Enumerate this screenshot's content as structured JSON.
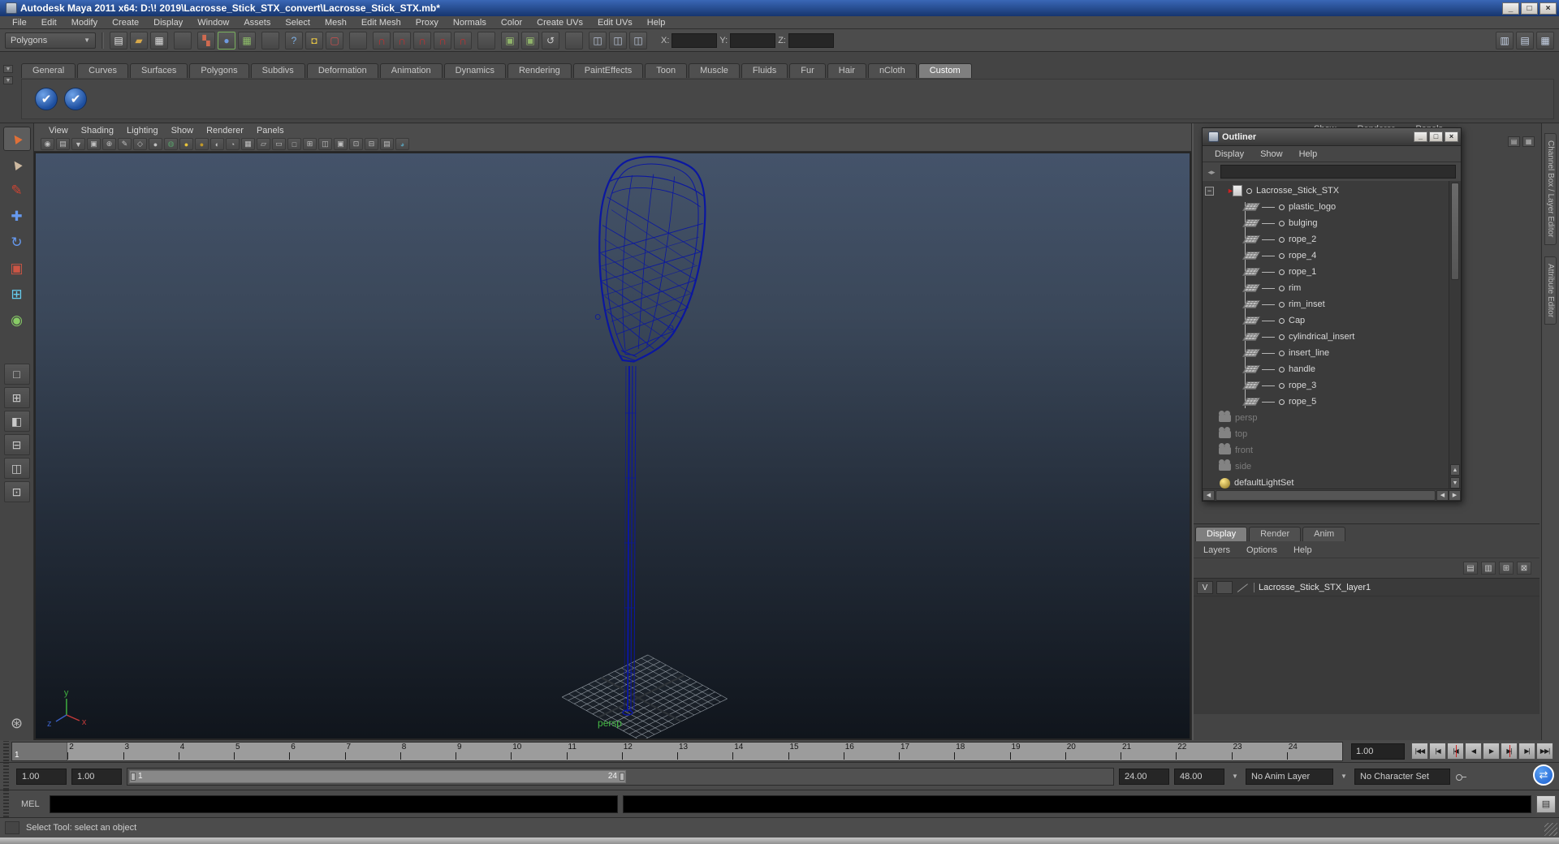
{
  "window": {
    "title": "Autodesk Maya 2011 x64: D:\\! 2019\\Lacrosse_Stick_STX_convert\\Lacrosse_Stick_STX.mb*",
    "minimize": "_",
    "maximize": "□",
    "close": "×"
  },
  "menubar": {
    "items": [
      "File",
      "Edit",
      "Modify",
      "Create",
      "Display",
      "Window",
      "Assets",
      "Select",
      "Mesh",
      "Edit Mesh",
      "Proxy",
      "Normals",
      "Color",
      "Create UVs",
      "Edit UVs",
      "Help"
    ]
  },
  "statusline": {
    "mode_label": "Polygons",
    "dropdown_arrow": "▼",
    "icons": [
      {
        "n": "new-scene-icon",
        "g": "▤",
        "c": "#e6e6e6"
      },
      {
        "n": "open-scene-icon",
        "g": "▰",
        "c": "#d8a94a"
      },
      {
        "n": "save-scene-icon",
        "g": "▦",
        "c": "#dcdcdc"
      },
      {
        "n": "divider",
        "cls": "sep",
        "g": "",
        "c": ""
      },
      {
        "n": "select-hierarchy-icon",
        "g": "▚",
        "c": "#cf6a50"
      },
      {
        "n": "select-object-icon",
        "g": "●",
        "c": "#6f9ae0",
        "cls": "framed"
      },
      {
        "n": "select-component-icon",
        "g": "▦",
        "c": "#8fbf6a"
      },
      {
        "n": "divider",
        "cls": "sep",
        "g": "",
        "c": ""
      },
      {
        "n": "help-highlight-icon",
        "g": "?",
        "c": "#7fb2e8"
      },
      {
        "n": "lock-selection-icon",
        "g": "◘",
        "c": "#e2c245"
      },
      {
        "n": "highlight-selection-icon",
        "g": "▢",
        "c": "#d05050"
      },
      {
        "n": "divider",
        "cls": "sep",
        "g": "",
        "c": ""
      },
      {
        "n": "snap-grid-icon",
        "g": "∩",
        "c": "#c23030",
        "cls": "mag"
      },
      {
        "n": "snap-curve-icon",
        "g": "∩",
        "c": "#c23030",
        "cls": "mag"
      },
      {
        "n": "snap-point-icon",
        "g": "∩",
        "c": "#c23030",
        "cls": "mag"
      },
      {
        "n": "snap-projected-center-icon",
        "g": "∩",
        "c": "#c23030",
        "cls": "mag"
      },
      {
        "n": "snap-view-plane-icon",
        "g": "∩",
        "c": "#c23030",
        "cls": "mag"
      },
      {
        "n": "divider",
        "cls": "sep",
        "g": "",
        "c": ""
      },
      {
        "n": "input-connections-icon",
        "g": "▣",
        "c": "#8fb36a"
      },
      {
        "n": "output-connections-icon",
        "g": "▣",
        "c": "#8fb36a"
      },
      {
        "n": "construction-history-icon",
        "g": "↺",
        "c": "#cccccc"
      },
      {
        "n": "divider",
        "cls": "sep",
        "g": "",
        "c": ""
      },
      {
        "n": "render-current-frame-icon",
        "g": "◫",
        "c": "#b9c5d9"
      },
      {
        "n": "ipr-render-icon",
        "g": "◫",
        "c": "#b9c5d9"
      },
      {
        "n": "render-settings-icon",
        "g": "◫",
        "c": "#b9c5d9"
      }
    ],
    "x_label": "X:",
    "y_label": "Y:",
    "z_label": "Z:",
    "x_value": "",
    "y_value": "",
    "z_value": "",
    "right_icons": [
      {
        "n": "show-channel-box-icon",
        "g": "▥",
        "c": "#c8d4e8"
      },
      {
        "n": "show-tool-settings-icon",
        "g": "▤",
        "c": "#c8d4e8"
      },
      {
        "n": "show-attribute-editor-icon",
        "g": "▦",
        "c": "#c8d4e8"
      }
    ]
  },
  "shelf": {
    "tabs": [
      {
        "label": "General",
        "cls": ""
      },
      {
        "label": "Curves",
        "cls": ""
      },
      {
        "label": "Surfaces",
        "cls": ""
      },
      {
        "label": "Polygons",
        "cls": ""
      },
      {
        "label": "Subdivs",
        "cls": ""
      },
      {
        "label": "Deformation",
        "cls": ""
      },
      {
        "label": "Animation",
        "cls": ""
      },
      {
        "label": "Dynamics",
        "cls": ""
      },
      {
        "label": "Rendering",
        "cls": ""
      },
      {
        "label": "PaintEffects",
        "cls": ""
      },
      {
        "label": "Toon",
        "cls": ""
      },
      {
        "label": "Muscle",
        "cls": ""
      },
      {
        "label": "Fluids",
        "cls": ""
      },
      {
        "label": "Fur",
        "cls": ""
      },
      {
        "label": "Hair",
        "cls": ""
      },
      {
        "label": "nCloth",
        "cls": ""
      },
      {
        "label": "Custom",
        "cls": "active"
      }
    ],
    "buttons": [
      {
        "n": "custom-shelf-button-1",
        "g": "✔"
      },
      {
        "n": "custom-shelf-button-2",
        "g": "✔"
      }
    ]
  },
  "toolbox": {
    "tools": [
      {
        "n": "select-tool",
        "g": "►",
        "c": "#e07038",
        "cls": "active",
        "rot": "rot"
      },
      {
        "n": "lasso-select-tool",
        "g": "►",
        "c": "#cdb9a0",
        "cls": "",
        "rot": "rot"
      },
      {
        "n": "paint-selection-tool",
        "g": "✎",
        "c": "#cc4433",
        "cls": "",
        "rot": ""
      },
      {
        "n": "move-tool",
        "g": "✚",
        "c": "#6699ee",
        "cls": "",
        "rot": ""
      },
      {
        "n": "rotate-tool",
        "g": "↻",
        "c": "#6699ee",
        "cls": "",
        "rot": ""
      },
      {
        "n": "scale-tool",
        "g": "▣",
        "c": "#cc5544",
        "cls": "",
        "rot": ""
      },
      {
        "n": "universal-manipulator-tool",
        "g": "⊞",
        "c": "#66ccee",
        "cls": "",
        "rot": ""
      },
      {
        "n": "soft-modification-tool",
        "g": "◉",
        "c": "#88cc66",
        "cls": "",
        "rot": ""
      }
    ],
    "layouts": [
      {
        "n": "single-pane-layout-button",
        "g": "□"
      },
      {
        "n": "four-pane-layout-button",
        "g": "⊞"
      },
      {
        "n": "persp-outliner-layout-button",
        "g": "◧"
      },
      {
        "n": "two-pane-stacked-layout-button",
        "g": "⊟"
      },
      {
        "n": "two-pane-side-layout-button",
        "g": "◫"
      },
      {
        "n": "persp-graph-layout-button",
        "g": "⊡"
      }
    ],
    "hand_glyph": "⊛"
  },
  "viewport": {
    "menu": [
      "View",
      "Shading",
      "Lighting",
      "Show",
      "Renderer",
      "Panels"
    ],
    "icons": [
      {
        "n": "select-camera-icon",
        "g": "◉",
        "c": "#c0c0c0"
      },
      {
        "n": "camera-attributes-icon",
        "g": "▤",
        "c": "#c0c0c0"
      },
      {
        "n": "bookmark-icon",
        "g": "▼",
        "c": "#c0c0c0"
      },
      {
        "n": "image-plane-icon",
        "g": "▣",
        "c": "#c0c0c0"
      },
      {
        "n": "2d-pan-zoom-icon",
        "g": "⊕",
        "c": "#c0c0c0"
      },
      {
        "n": "grease-pencil-icon",
        "g": "✎",
        "c": "#c0c0c0"
      },
      {
        "n": "wireframe-icon",
        "g": "◇",
        "c": "#c0c0c0"
      },
      {
        "n": "shaded-icon",
        "g": "●",
        "c": "#c0c0c0"
      },
      {
        "n": "textured-icon",
        "g": "◍",
        "c": "#59a06a"
      },
      {
        "n": "use-all-lights-icon",
        "g": "●",
        "c": "#e8c43a"
      },
      {
        "n": "shadows-icon",
        "g": "●",
        "c": "#c0982a"
      },
      {
        "n": "screen-ao-icon",
        "g": "◐",
        "c": "#c0c0c0"
      },
      {
        "n": "motion-blur-icon",
        "g": "◔",
        "c": "#c0c0c0"
      },
      {
        "n": "multisample-icon",
        "g": "▦",
        "c": "#c0c0c0"
      },
      {
        "n": "xray-icon",
        "g": "▱",
        "c": "#c0c0c0"
      },
      {
        "n": "xray-joints-icon",
        "g": "▭",
        "c": "#c0c0c0"
      },
      {
        "n": "isolate-select-icon",
        "g": "□",
        "c": "#c0c0c0"
      },
      {
        "n": "field-chart-icon",
        "g": "⊞",
        "c": "#c0c0c0"
      },
      {
        "n": "resolution-gate-icon",
        "g": "◫",
        "c": "#c0c0c0"
      },
      {
        "n": "gate-mask-icon",
        "g": "▣",
        "c": "#c0c0c0"
      },
      {
        "n": "safe-action-icon",
        "g": "⊡",
        "c": "#c0c0c0"
      },
      {
        "n": "safe-title-icon",
        "g": "⊟",
        "c": "#c0c0c0"
      },
      {
        "n": "hud-icon",
        "g": "▤",
        "c": "#c0c0c0"
      },
      {
        "n": "default-material-icon",
        "g": "◕",
        "c": "#5a9ab0"
      }
    ],
    "camera_label": "persp",
    "axis": {
      "x": "x",
      "y": "y",
      "z": "z"
    }
  },
  "right_panel": {
    "partial_menu": [
      "Show",
      "Renderer",
      "Panels"
    ],
    "pane_icons": [
      {
        "n": "pane-menu-icon",
        "g": "▤"
      },
      {
        "n": "pane-split-icon",
        "g": "▦"
      }
    ]
  },
  "outliner": {
    "title": "Outliner",
    "menu": [
      "Display",
      "Show",
      "Help"
    ],
    "search_value": "",
    "filter_glyph": "◂▸",
    "expand_glyph": "−",
    "root": "Lacrosse_Stick_STX",
    "children": [
      "plastic_logo",
      "bulging",
      "rope_2",
      "rope_4",
      "rope_1",
      "rim",
      "rim_inset",
      "Cap",
      "cylindrical_insert",
      "insert_line",
      "handle",
      "rope_3",
      "rope_5"
    ],
    "cameras": [
      "persp",
      "top",
      "front",
      "side"
    ],
    "light_set": "defaultLightSet"
  },
  "layer_editor": {
    "tabs": [
      {
        "label": "Display",
        "cls": "active"
      },
      {
        "label": "Render",
        "cls": ""
      },
      {
        "label": "Anim",
        "cls": ""
      }
    ],
    "menu": [
      "Layers",
      "Options",
      "Help"
    ],
    "icons": [
      {
        "n": "layer-sort-icon",
        "g": "▤"
      },
      {
        "n": "layer-list-icon",
        "g": "▥"
      },
      {
        "n": "new-empty-layer-icon",
        "g": "⊞"
      },
      {
        "n": "new-layer-from-selected-icon",
        "g": "⊠"
      }
    ],
    "layer": {
      "visible": "V",
      "name": "Lacrosse_Stick_STX_layer1"
    }
  },
  "timeline": {
    "frames": [
      "1",
      "2",
      "3",
      "4",
      "5",
      "6",
      "7",
      "8",
      "9",
      "10",
      "11",
      "12",
      "13",
      "14",
      "15",
      "16",
      "17",
      "18",
      "19",
      "20",
      "21",
      "22",
      "23",
      "24"
    ],
    "current": "1",
    "time_field": "1.00"
  },
  "playback": [
    {
      "n": "go-to-start-button",
      "g": "|◀◀",
      "cls": ""
    },
    {
      "n": "step-back-frame-button",
      "g": "|◀",
      "cls": ""
    },
    {
      "n": "step-back-key-button",
      "g": "|◀",
      "cls": "redmark"
    },
    {
      "n": "play-backwards-button",
      "g": "◀",
      "cls": ""
    },
    {
      "n": "play-forwards-button",
      "g": "▶",
      "cls": ""
    },
    {
      "n": "step-forward-key-button",
      "g": "▶|",
      "cls": "redmark"
    },
    {
      "n": "step-forward-frame-button",
      "g": "▶|",
      "cls": ""
    },
    {
      "n": "go-to-end-button",
      "g": "▶▶|",
      "cls": ""
    }
  ],
  "range": {
    "field_min": "1.00",
    "field_start": "1.00",
    "inner_start": "1",
    "inner_end": "24",
    "field_end": "24.00",
    "field_max": "48.00",
    "anim_layer": "No Anim Layer",
    "character_set": "No Character Set",
    "dropdown_arrow": "▼"
  },
  "mel": {
    "label": "MEL",
    "input_value": ""
  },
  "help_line": {
    "text": "Select Tool: select an object"
  },
  "side_tabs": [
    "Channel Box / Layer Editor",
    "Attribute Editor"
  ],
  "remote_icon_glyph": "⇄"
}
